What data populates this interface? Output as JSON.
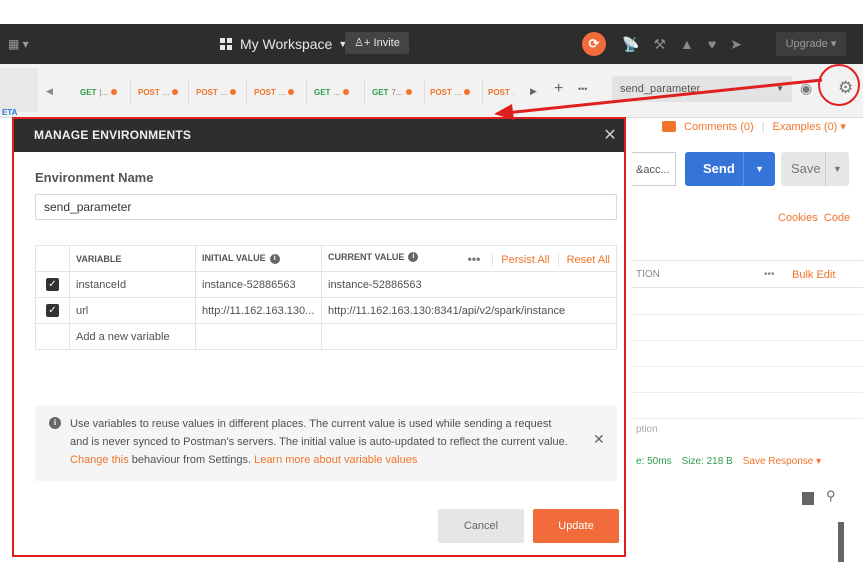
{
  "topbar": {
    "workspace_label": "My Workspace",
    "invite_label": "Invite",
    "upgrade_label": "Upgrade"
  },
  "tabs": [
    {
      "method": "GET",
      "name": "|..."
    },
    {
      "method": "POST",
      "name": "..."
    },
    {
      "method": "POST",
      "name": "..."
    },
    {
      "method": "POST",
      "name": "..."
    },
    {
      "method": "GET",
      "name": "..."
    },
    {
      "method": "GET",
      "name": "7..."
    },
    {
      "method": "POST",
      "name": "..."
    },
    {
      "method": "POST",
      "name": "."
    }
  ],
  "tabbar": {
    "beta_label": "ETA",
    "add_tab": "+",
    "more": "•••"
  },
  "environment_select": {
    "value": "send_parameter"
  },
  "background": {
    "comments": "Comments (0)",
    "examples": "Examples (0)",
    "url_fragment": "&acc...",
    "send": "Send",
    "save": "Save",
    "cookies": "Cookies",
    "code": "Code",
    "header_col": "TION",
    "bulk_edit": "Bulk Edit",
    "option": "ption",
    "status_time": "e: 50ms",
    "status_size": "Size: 218 B",
    "save_response": "Save Response"
  },
  "modal": {
    "title": "MANAGE ENVIRONMENTS",
    "env_name_label": "Environment Name",
    "env_name_value": "send_parameter",
    "table": {
      "headers": {
        "variable": "VARIABLE",
        "initial": "INITIAL VALUE",
        "current": "CURRENT VALUE",
        "persist_all": "Persist All",
        "reset_all": "Reset All"
      },
      "rows": [
        {
          "variable": "instanceId",
          "initial": "instance-52886563",
          "current": "instance-52886563"
        },
        {
          "variable": "url",
          "initial": "http://11.162.163.130...",
          "current": "http://11.162.163.130:8341/api/v2/spark/instance"
        }
      ],
      "add_placeholder": "Add a new variable"
    },
    "info": {
      "text_1": "Use variables to reuse values in different places. The current value is used while sending a request and is never synced to Postman's servers. The initial value is auto-updated to reflect the current value.",
      "link_change": "Change this",
      "text_2": "behaviour from Settings.",
      "link_learn": "Learn more about variable values"
    },
    "cancel_label": "Cancel",
    "update_label": "Update"
  },
  "colors": {
    "accent": "#f26b3a",
    "annotation": "#e02020",
    "send_blue": "#3575d9",
    "header_dark": "#2e2e2e"
  }
}
